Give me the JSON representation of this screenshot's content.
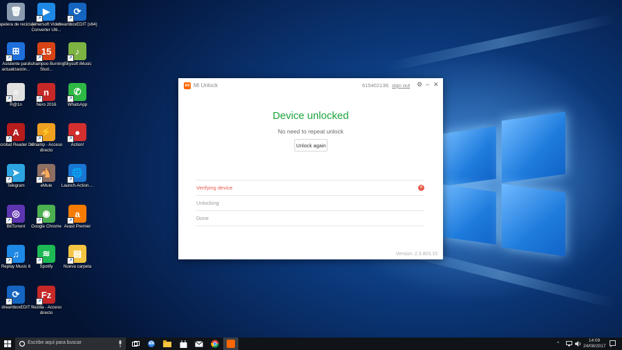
{
  "desktop": {
    "icons": [
      {
        "label": "Papelera de reciclaje",
        "color": "#8a9bb0",
        "glyph": "🗑"
      },
      {
        "label": "Aimersoft Video Converter Ulti...",
        "color": "#1e88e5",
        "glyph": "▶"
      },
      {
        "label": "dreamboxEDIT (x64)",
        "color": "#1565c0",
        "glyph": "⟳"
      },
      {
        "label": "Asistente para actualización...",
        "color": "#1e6fd9",
        "glyph": "⊞"
      },
      {
        "label": "Ashampoo Burning Stud...",
        "color": "#d84315",
        "glyph": "15"
      },
      {
        "label": "iSkysoft iMusic",
        "color": "#7cb342",
        "glyph": "♪"
      },
      {
        "label": "R@1n",
        "color": "#e0e0e0",
        "glyph": "≡"
      },
      {
        "label": "Nero 2016",
        "color": "#c62828",
        "glyph": "n"
      },
      {
        "label": "WhatsApp",
        "color": "#2eb845",
        "glyph": "✆"
      },
      {
        "label": "Acrobat Reader DC",
        "color": "#b71c1c",
        "glyph": "A"
      },
      {
        "label": "winamp - Acceso directo",
        "color": "#f0a020",
        "glyph": "⚡"
      },
      {
        "label": "Action!",
        "color": "#d32f2f",
        "glyph": "●"
      },
      {
        "label": "Telegram",
        "color": "#2ca5e0",
        "glyph": "➤"
      },
      {
        "label": "eMule",
        "color": "#8d6e63",
        "glyph": "🐴"
      },
      {
        "label": "Launch-Action....",
        "color": "#1976d2",
        "glyph": "🌐"
      },
      {
        "label": "BitTorrent",
        "color": "#5e35b1",
        "glyph": "◎"
      },
      {
        "label": "Google Chrome",
        "color": "#4caf50",
        "glyph": "◉"
      },
      {
        "label": "Avast Premier",
        "color": "#f57c00",
        "glyph": "a"
      },
      {
        "label": "Replay Music 6",
        "color": "#1e88e5",
        "glyph": "♫"
      },
      {
        "label": "Spotify",
        "color": "#1db954",
        "glyph": "≋"
      },
      {
        "label": "Nueva carpeta",
        "color": "#f4c542",
        "glyph": "▤"
      },
      {
        "label": "dreamboxEDIT",
        "color": "#1565c0",
        "glyph": "⟳"
      },
      {
        "label": "filezilla - Acceso directo",
        "color": "#c62828",
        "glyph": "Fz"
      }
    ]
  },
  "window": {
    "logo": "mi",
    "title": "Mi Unlock",
    "account_id": "615402136",
    "separator": "|",
    "signout_label": "sign out",
    "settings_glyph": "⚙",
    "minimize_glyph": "–",
    "close_glyph": "✕",
    "headline": "Device unlocked",
    "subtext": "No need to repeat unlock",
    "unlock_again_label": "Unlock again",
    "steps": [
      {
        "label": "Verifying device",
        "status": "error",
        "color": "#e65a4b"
      },
      {
        "label": "Unlocking",
        "status": "pending",
        "color": "#999999"
      },
      {
        "label": "Done",
        "status": "pending",
        "color": "#999999"
      }
    ],
    "error_glyph": "✕",
    "version": "Version: 2.3.803.10"
  },
  "taskbar": {
    "search_placeholder": "Escribe aquí para buscar",
    "time": "14:09",
    "date": "24/08/2017"
  }
}
